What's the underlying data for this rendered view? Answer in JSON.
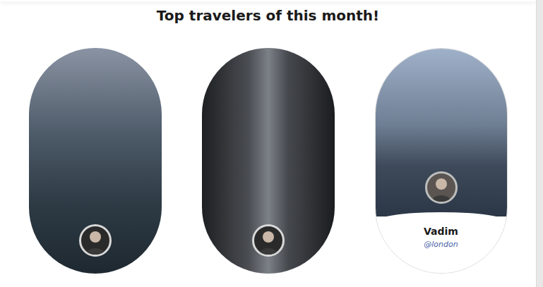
{
  "title": "Top travelers of this month!",
  "travelers": [
    {
      "expanded": false
    },
    {
      "expanded": false
    },
    {
      "name": "Vadim",
      "handle": "@london",
      "expanded": true
    }
  ]
}
